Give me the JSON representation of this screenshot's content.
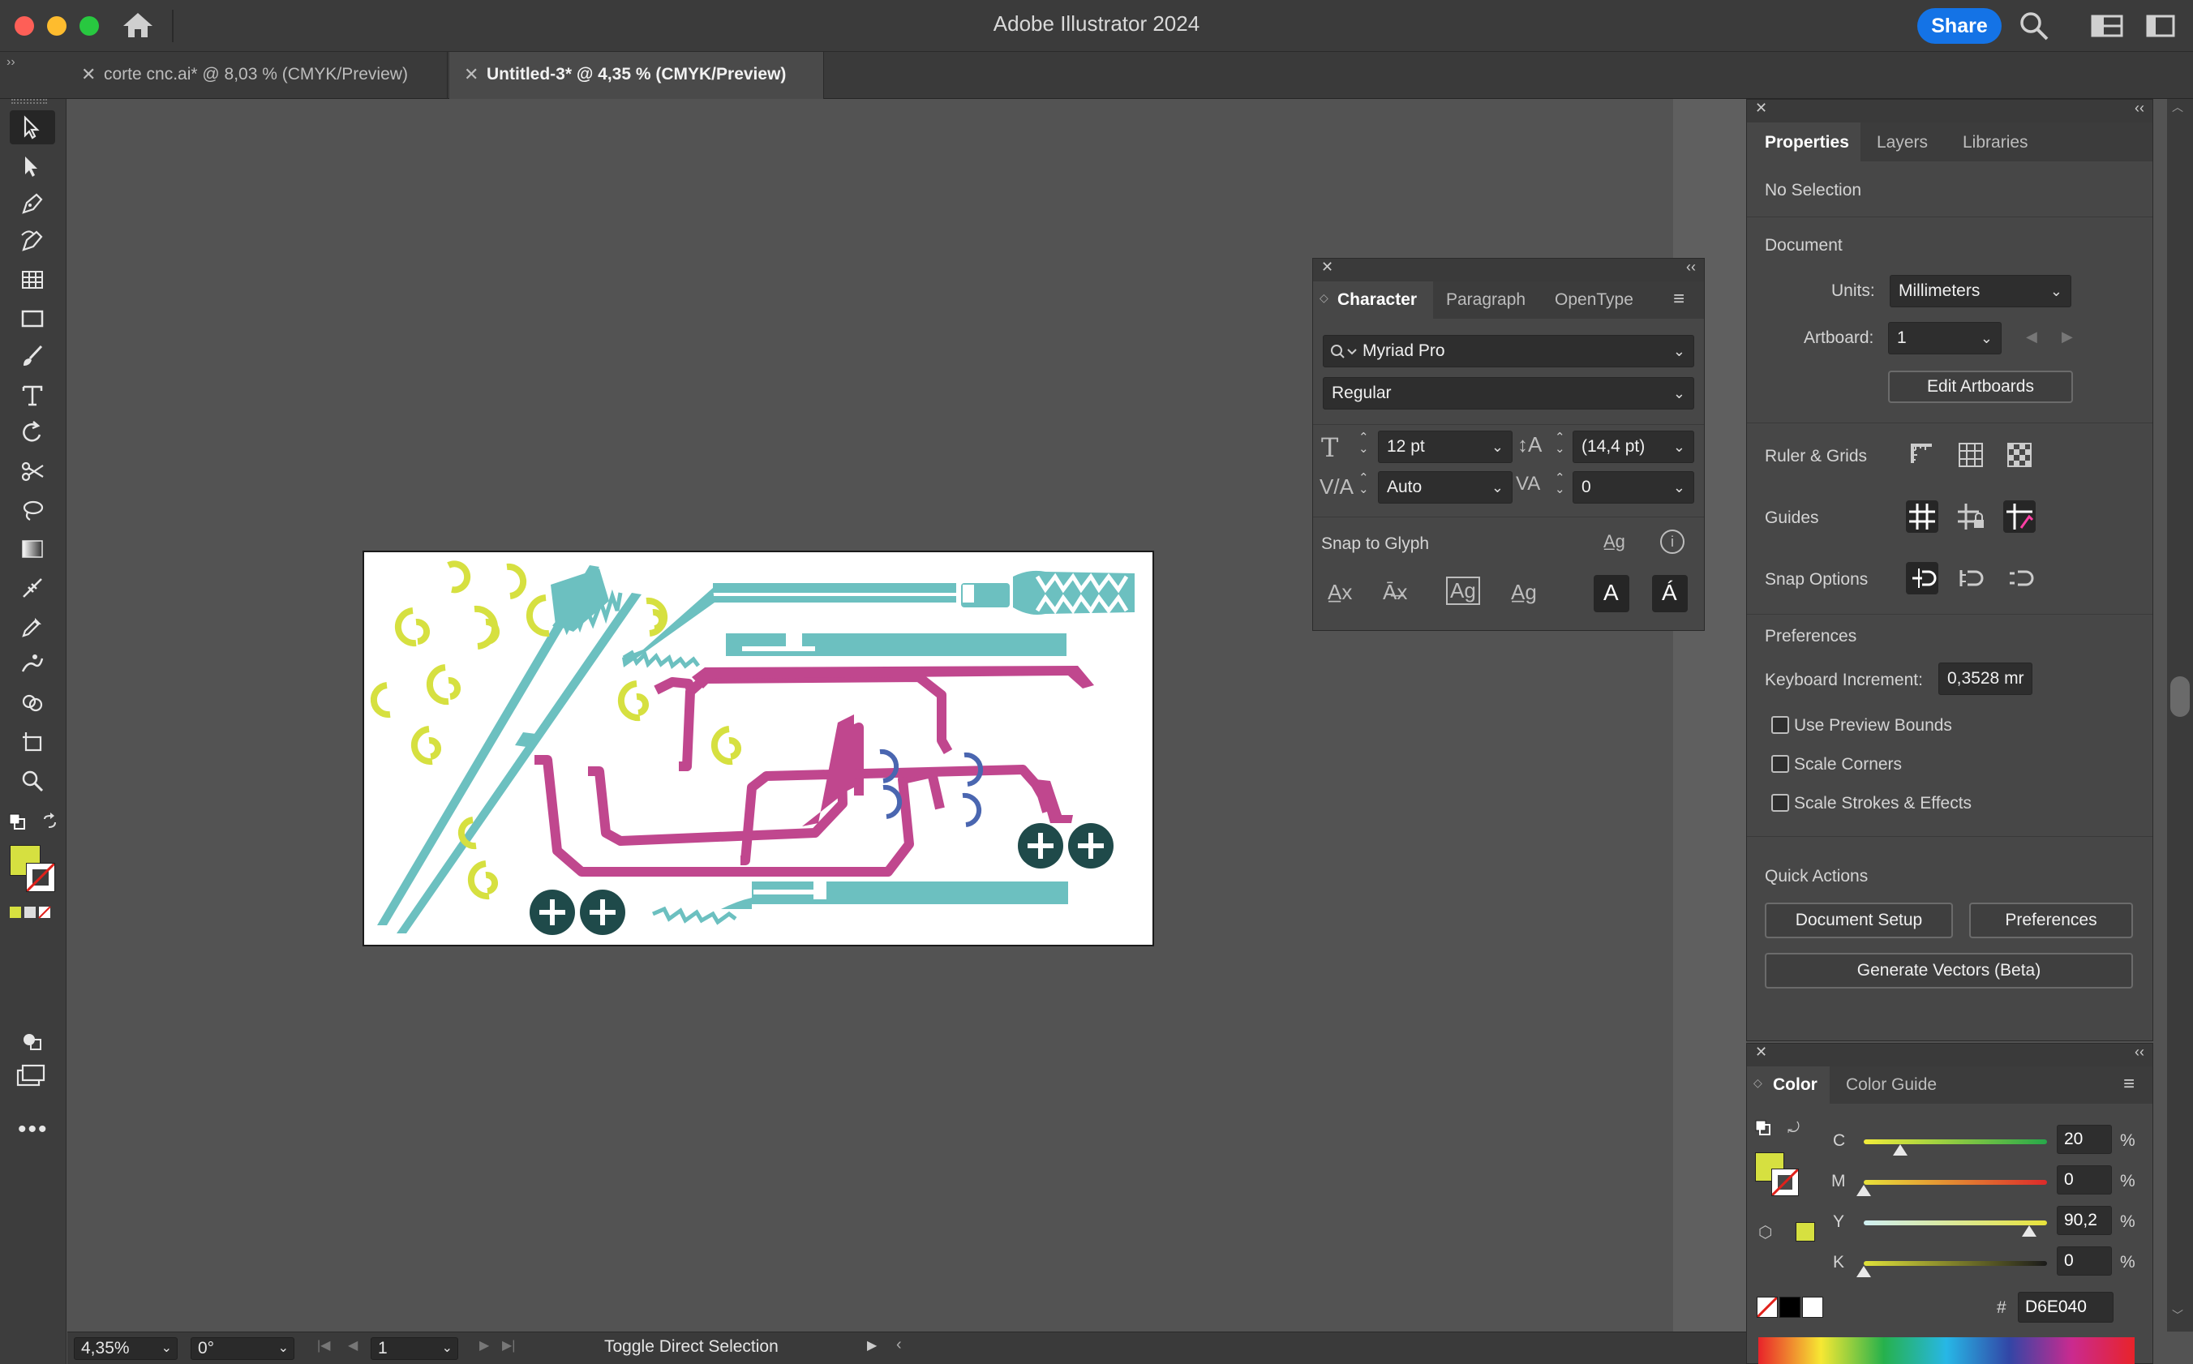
{
  "app": {
    "title": "Adobe Illustrator 2024",
    "share_label": "Share"
  },
  "tabs": [
    {
      "label": "corte cnc.ai* @ 8,03 % (CMYK/Preview)",
      "active": false
    },
    {
      "label": "Untitled-3* @ 4,35 % (CMYK/Preview)",
      "active": true
    }
  ],
  "tools": [
    "selection-tool",
    "direct-selection-tool",
    "pen-tool",
    "curvature-tool",
    "grid-tool",
    "rectangle-tool",
    "paintbrush-tool",
    "type-tool",
    "rotate-tool",
    "scissors-tool",
    "lasso-tool",
    "gradient-tool",
    "width-tool",
    "eyedropper-tool",
    "puppet-warp-tool",
    "shape-builder-tool",
    "artboard-tool",
    "zoom-tool"
  ],
  "character_panel": {
    "tabs": [
      "Character",
      "Paragraph",
      "OpenType"
    ],
    "font_family": "Myriad Pro",
    "font_style": "Regular",
    "font_size": "12 pt",
    "leading": "(14,4 pt)",
    "kerning": "Auto",
    "tracking": "0",
    "snap_to_glyph": "Snap to Glyph"
  },
  "properties_panel": {
    "tabs": [
      "Properties",
      "Layers",
      "Libraries"
    ],
    "selection_status": "No Selection",
    "document_heading": "Document",
    "units_label": "Units:",
    "units_value": "Millimeters",
    "artboard_label": "Artboard:",
    "artboard_value": "1",
    "edit_artboards": "Edit Artboards",
    "ruler_grids": "Ruler & Grids",
    "guides": "Guides",
    "snap_options": "Snap Options",
    "preferences_heading": "Preferences",
    "keyboard_increment_label": "Keyboard Increment:",
    "keyboard_increment_value": "0,3528 mr",
    "checkboxes": [
      "Use Preview Bounds",
      "Scale Corners",
      "Scale Strokes & Effects"
    ],
    "quick_actions": "Quick Actions",
    "document_setup": "Document Setup",
    "preferences_button": "Preferences",
    "generate_vectors": "Generate Vectors (Beta)"
  },
  "color_panel": {
    "tabs": [
      "Color",
      "Color Guide"
    ],
    "channels": [
      {
        "label": "C",
        "value": "20",
        "unit": "%",
        "level": 0.2
      },
      {
        "label": "M",
        "value": "0",
        "unit": "%",
        "level": 0.0
      },
      {
        "label": "Y",
        "value": "90,2",
        "unit": "%",
        "level": 0.902
      },
      {
        "label": "K",
        "value": "0",
        "unit": "%",
        "level": 0.0
      }
    ],
    "hex_label": "#",
    "hex_value": "D6E040",
    "fill_color": "#D6E040"
  },
  "status_bar": {
    "zoom": "4,35%",
    "rotation": "0°",
    "artboard_number": "1",
    "status_text": "Toggle Direct Selection"
  },
  "colors": {
    "yellow": "#D6E040",
    "teal": "#6CC0C0",
    "magenta": "#C0478E",
    "blue": "#4A66B0",
    "dark_teal": "#1F4A4A",
    "accent": "#1473E6"
  }
}
